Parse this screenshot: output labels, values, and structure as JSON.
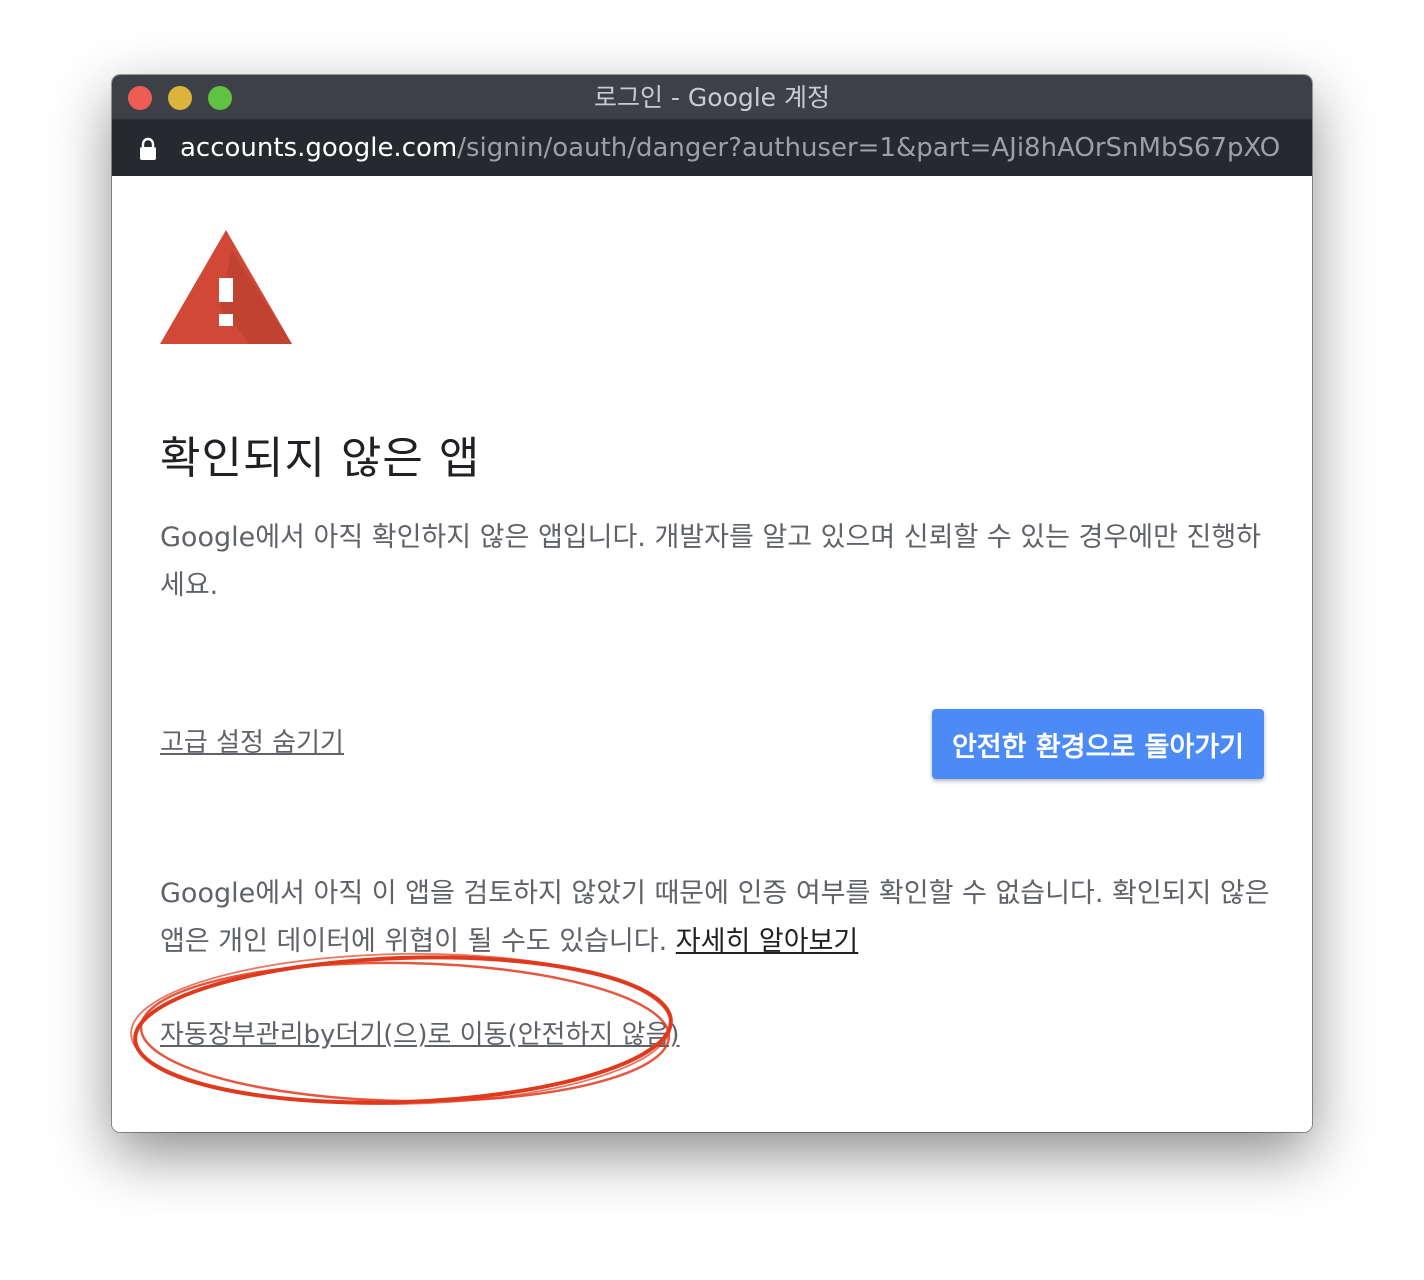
{
  "window": {
    "title": "로그인 - Google 계정"
  },
  "address_bar": {
    "host": "accounts.google.com",
    "path": "/signin/oauth/danger?authuser=1&part=AJi8hAOrSnMbS67pXOl..."
  },
  "page": {
    "heading": "확인되지 않은 앱",
    "description": "Google에서 아직 확인하지 않은 앱입니다. 개발자를 알고 있으며 신뢰할 수 있는 경우에만 진행하세요.",
    "hide_advanced_label": "고급 설정 숨기기",
    "back_to_safety_label": "안전한 환경으로 돌아가기",
    "advanced_text": "Google에서 아직 이 앱을 검토하지 않았기 때문에 인증 여부를 확인할 수 없습니다. 확인되지 않은 앱은 개인 데이터에 위협이 될 수도 있습니다.",
    "learn_more_label": "자세히 알아보기",
    "proceed_label": "자동장부관리by더기(으)로 이동(안전하지 않음)"
  },
  "icons": {
    "warning": "warning-triangle-icon",
    "lock": "lock-icon"
  },
  "colors": {
    "warning_red": "#d14836",
    "button_blue": "#4c8bf5",
    "annotation_red": "#e03a1e"
  }
}
